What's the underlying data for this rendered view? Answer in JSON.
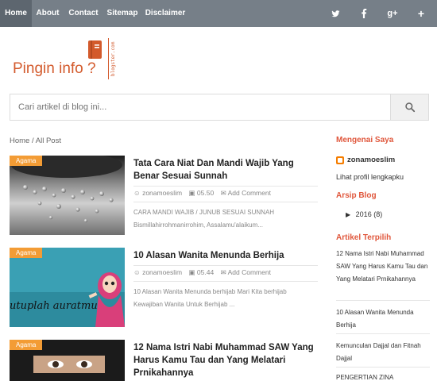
{
  "nav": {
    "items": [
      "Home",
      "About",
      "Contact",
      "Sitemap",
      "Disclaimer"
    ],
    "social": [
      "twitter-icon",
      "facebook-icon",
      "google-plus-icon",
      "plus-icon"
    ]
  },
  "brand": {
    "logo_text": "Pingin info ?",
    "logo_side": "blogster.com",
    "accent": "#d35a2c"
  },
  "search": {
    "placeholder": "Cari artikel di blog ini..."
  },
  "breadcrumb": {
    "home": "Home",
    "sep": " / ",
    "current": "All Post"
  },
  "posts": [
    {
      "tag": "Agama",
      "title": "Tata Cara Niat Dan Mandi Wajib Yang Benar Sesuai Sunnah",
      "author": "zonamoeslim",
      "time": "05.50",
      "comment": "Add Comment",
      "excerpt": "CARA MANDI WAJIB / JUNUB SESUAI SUNNAH Bismillahirrohmanirrohim, Assalamu'alaikum..."
    },
    {
      "tag": "Agama",
      "title": "10 Alasan Wanita Menunda Berhija",
      "author": "zonamoeslim",
      "time": "05.44",
      "comment": "Add Comment",
      "excerpt": "10 Alasan Wanita Menunda berhijab Mari Kita berhijab Kewajiban Wanita Untuk Berhijab ...",
      "thumb_text": "utuplah auratmu"
    },
    {
      "tag": "Agama",
      "title": "12 Nama Istri Nabi Muhammad SAW Yang Harus Kamu Tau dan Yang Melatari Prnikahannya"
    }
  ],
  "sidebar": {
    "about_heading": "Mengenai Saya",
    "profile_name": "zonamoeslim",
    "profile_link": "Lihat profil lengkapku",
    "archive_heading": "Arsip Blog",
    "archive_item": "2016",
    "archive_count": "(8)",
    "popular_heading": "Artikel Terpilih",
    "popular": [
      "12 Nama Istri Nabi Muhammad SAW Yang Harus Kamu Tau dan Yang Melatari Prnikahannya",
      "10 Alasan Wanita Menunda Berhija",
      "Kemunculan Dajjal dan Fitnah Dajjal",
      "PENGERTIAN ZINA"
    ]
  }
}
